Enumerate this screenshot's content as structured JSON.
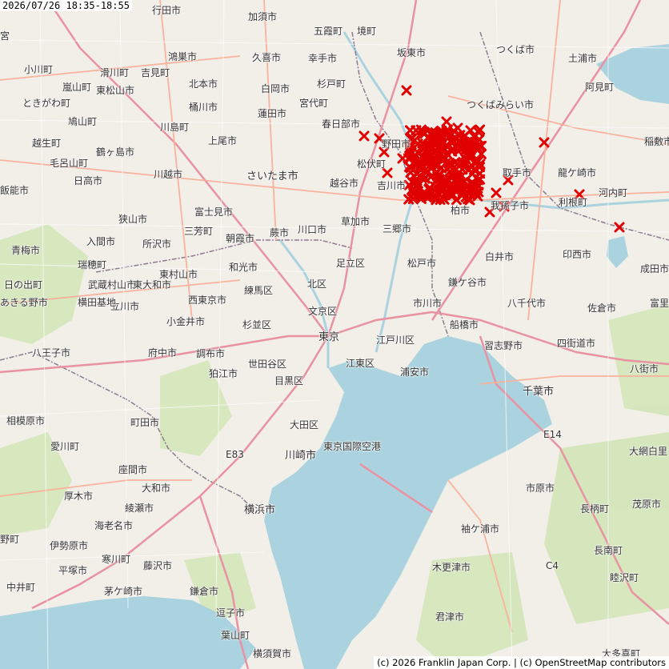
{
  "timestamp": "2026/07/26 18:35-18:55",
  "attribution": "(c) 2026 Franklin Japan Corp. | (c) OpenStreetMap contributors",
  "colors": {
    "water": "#aad3df",
    "land": "#f2efe9",
    "road_major": "#e892a2",
    "road_trunk": "#f9b29c",
    "border": "#8c7a8f",
    "lightning": "#e00000"
  },
  "places": [
    {
      "name": "行田市"
    },
    {
      "name": "加須市"
    },
    {
      "name": "五霞町"
    },
    {
      "name": "境町"
    },
    {
      "name": "坂東市"
    },
    {
      "name": "つくば市"
    },
    {
      "name": "土浦市"
    },
    {
      "name": "鴻巣市"
    },
    {
      "name": "久喜市"
    },
    {
      "name": "幸手市"
    },
    {
      "name": "吉見町"
    },
    {
      "name": "東松山市"
    },
    {
      "name": "北本市"
    },
    {
      "name": "白岡市"
    },
    {
      "name": "杉戸町"
    },
    {
      "name": "宮代町"
    },
    {
      "name": "つくばみらい市"
    },
    {
      "name": "阿見町"
    },
    {
      "name": "桶川市"
    },
    {
      "name": "蓮田市"
    },
    {
      "name": "上尾市"
    },
    {
      "name": "春日部市"
    },
    {
      "name": "稲敷市"
    },
    {
      "name": "鶴ヶ島市"
    },
    {
      "name": "野田市"
    },
    {
      "name": "松伏町"
    },
    {
      "name": "取手市"
    },
    {
      "name": "龍ケ崎市"
    },
    {
      "name": "日高市"
    },
    {
      "name": "川越市"
    },
    {
      "name": "さいたま市"
    },
    {
      "name": "越谷市"
    },
    {
      "name": "吉川市"
    },
    {
      "name": "飯能市"
    },
    {
      "name": "富士見市"
    },
    {
      "name": "利根町"
    },
    {
      "name": "河内町"
    },
    {
      "name": "狭山市"
    },
    {
      "name": "蕨市"
    },
    {
      "name": "川口市"
    },
    {
      "name": "草加市"
    },
    {
      "name": "三郷市"
    },
    {
      "name": "柏市"
    },
    {
      "name": "我孫子市"
    },
    {
      "name": "入間市"
    },
    {
      "name": "所沢市"
    },
    {
      "name": "朝霞市"
    },
    {
      "name": "三芳町"
    },
    {
      "name": "青梅市"
    },
    {
      "name": "和光市"
    },
    {
      "name": "足立区"
    },
    {
      "name": "松戸市"
    },
    {
      "name": "白井市"
    },
    {
      "name": "印西市"
    },
    {
      "name": "成田市"
    },
    {
      "name": "瑞穂町"
    },
    {
      "name": "東村山市"
    },
    {
      "name": "練馬区"
    },
    {
      "name": "北区"
    },
    {
      "name": "鎌ケ谷市"
    },
    {
      "name": "日の出町"
    },
    {
      "name": "武蔵村山市"
    },
    {
      "name": "東大和市"
    },
    {
      "name": "西東京市"
    },
    {
      "name": "文京区"
    },
    {
      "name": "市川市"
    },
    {
      "name": "八千代市"
    },
    {
      "name": "佐倉市"
    },
    {
      "name": "あきる野市"
    },
    {
      "name": "立川市"
    },
    {
      "name": "横田基地"
    },
    {
      "name": "小金井市"
    },
    {
      "name": "杉並区"
    },
    {
      "name": "船橋市"
    },
    {
      "name": "習志野市"
    },
    {
      "name": "四街道市"
    },
    {
      "name": "東京"
    },
    {
      "name": "江戸川区"
    },
    {
      "name": "八王子市"
    },
    {
      "name": "府中市"
    },
    {
      "name": "調布市"
    },
    {
      "name": "世田谷区"
    },
    {
      "name": "江東区"
    },
    {
      "name": "八街市"
    },
    {
      "name": "狛江市"
    },
    {
      "name": "浦安市"
    },
    {
      "name": "目黒区"
    },
    {
      "name": "千葉市"
    },
    {
      "name": "相模原市"
    },
    {
      "name": "町田市"
    },
    {
      "name": "大田区"
    },
    {
      "name": "東京国際空港"
    },
    {
      "name": "E14"
    },
    {
      "name": "大網白里"
    },
    {
      "name": "愛川町"
    },
    {
      "name": "E83"
    },
    {
      "name": "川崎市"
    },
    {
      "name": "座間市"
    },
    {
      "name": "厚木市"
    },
    {
      "name": "大和市"
    },
    {
      "name": "市原市"
    },
    {
      "name": "茂原市"
    },
    {
      "name": "綾瀬市"
    },
    {
      "name": "横浜市"
    },
    {
      "name": "長柄町"
    },
    {
      "name": "海老名市"
    },
    {
      "name": "袖ケ浦市"
    },
    {
      "name": "伊勢原市"
    },
    {
      "name": "寒川町"
    },
    {
      "name": "長南町"
    },
    {
      "name": "平塚市"
    },
    {
      "name": "藤沢市"
    },
    {
      "name": "木更津市"
    },
    {
      "name": "C4"
    },
    {
      "name": "睦沢町"
    },
    {
      "name": "茅ケ崎市"
    },
    {
      "name": "鎌倉市"
    },
    {
      "name": "中井町"
    },
    {
      "name": "逗子市"
    },
    {
      "name": "君津市"
    },
    {
      "name": "大多喜町"
    },
    {
      "name": "横須賀市"
    },
    {
      "name": "葉山町"
    },
    {
      "name": "富里"
    },
    {
      "name": "野町"
    },
    {
      "name": "小川町"
    },
    {
      "name": "滑川町"
    },
    {
      "name": "嵐山町"
    },
    {
      "name": "ときがわ町"
    },
    {
      "name": "鳩山町"
    },
    {
      "name": "毛呂山町"
    },
    {
      "name": "越生町"
    },
    {
      "name": "川島町"
    },
    {
      "name": "宮"
    }
  ],
  "lightning": {
    "symbol": "✕",
    "count": 290
  }
}
